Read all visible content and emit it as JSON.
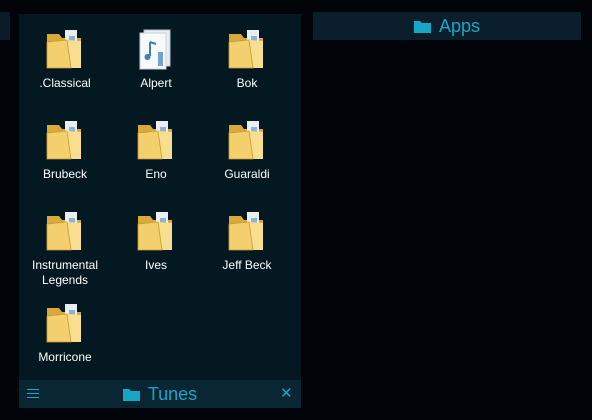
{
  "apps_panel": {
    "title": "Apps",
    "icon": "folder-icon"
  },
  "tunes_panel": {
    "title": "Tunes",
    "icon": "folder-icon",
    "menu_icon": "hamburger-icon",
    "close_icon": "close-icon",
    "items": [
      {
        "label": ".Classical",
        "icon": "folder-icon"
      },
      {
        "label": "Alpert",
        "icon": "music-file-icon"
      },
      {
        "label": "Bok",
        "icon": "folder-icon"
      },
      {
        "label": "Brubeck",
        "icon": "folder-icon"
      },
      {
        "label": "Eno",
        "icon": "folder-icon"
      },
      {
        "label": "Guaraldi",
        "icon": "folder-icon"
      },
      {
        "label": "Instrumental Legends",
        "icon": "folder-icon"
      },
      {
        "label": "Ives",
        "icon": "folder-icon"
      },
      {
        "label": "Jeff Beck",
        "icon": "folder-icon"
      },
      {
        "label": "Morricone",
        "icon": "folder-icon"
      }
    ]
  },
  "colors": {
    "accent": "#16a7c7",
    "background": "#010409",
    "panel": "#031821",
    "footer": "#0b2633",
    "folder": "#f4d77c"
  }
}
